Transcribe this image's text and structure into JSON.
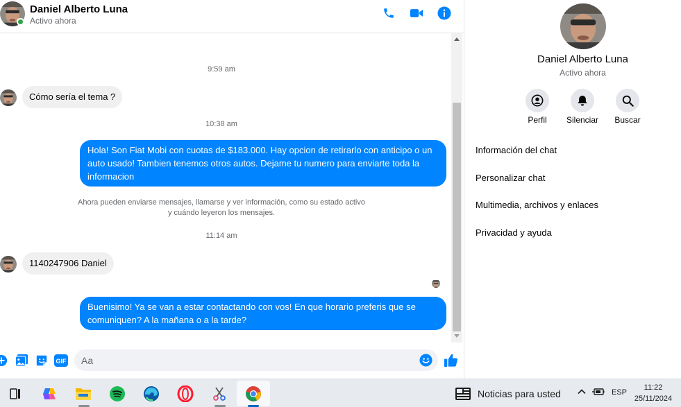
{
  "chat_header": {
    "name": "Daniel Alberto Luna",
    "status": "Activo ahora",
    "actions": [
      "phone-icon",
      "video-camera-icon",
      "info-icon"
    ]
  },
  "messages": {
    "timestamps": [
      "9:59 am",
      "10:38 am",
      "11:14 am"
    ],
    "incoming_1": "Cómo sería el tema ?",
    "outgoing_1": "Hola! Son Fiat Mobi con cuotas de $183.000. Hay opcion de retirarlo con anticipo o un auto usado! Tambien tenemos otros autos. Dejame tu numero para enviarte toda la informacion",
    "system_note_line1": "Ahora pueden enviarse mensajes, llamarse y ver información, como su estado activo",
    "system_note_line2": "y cuándo leyeron los mensajes.",
    "incoming_2": "1140247906 Daniel",
    "outgoing_2": "Buenisimo! Ya se van a estar contactando con vos! En que horario preferis que se comuniquen? A la mañana o a la tarde?"
  },
  "composer": {
    "placeholder": "Aa",
    "gif_label": "GIF",
    "icons": [
      "plus-icon",
      "image-icon",
      "sticker-icon",
      "gif-icon",
      "emoji-icon",
      "thumbs-up-icon"
    ]
  },
  "info_panel": {
    "name": "Daniel Alberto Luna",
    "status": "Activo ahora",
    "actions": [
      {
        "label": "Perfil",
        "icon": "profile-icon"
      },
      {
        "label": "Silenciar",
        "icon": "bell-icon"
      },
      {
        "label": "Buscar",
        "icon": "search-icon"
      }
    ],
    "menu": [
      "Información del chat",
      "Personalizar chat",
      "Multimedia, archivos y enlaces",
      "Privacidad y ayuda"
    ]
  },
  "taskbar": {
    "apps": [
      "task-view-icon",
      "copilot-icon",
      "file-explorer-icon",
      "spotify-icon",
      "edge-icon",
      "opera-icon",
      "snipping-tool-icon",
      "chrome-icon"
    ],
    "news_label": "Noticias para usted",
    "language": "ESP",
    "time": "11:22",
    "date": "25/11/2024"
  },
  "colors": {
    "accent": "#0084ff",
    "online": "#31a24c",
    "incoming_bubble": "#f0f0f0",
    "secondary_text": "#65676b"
  }
}
